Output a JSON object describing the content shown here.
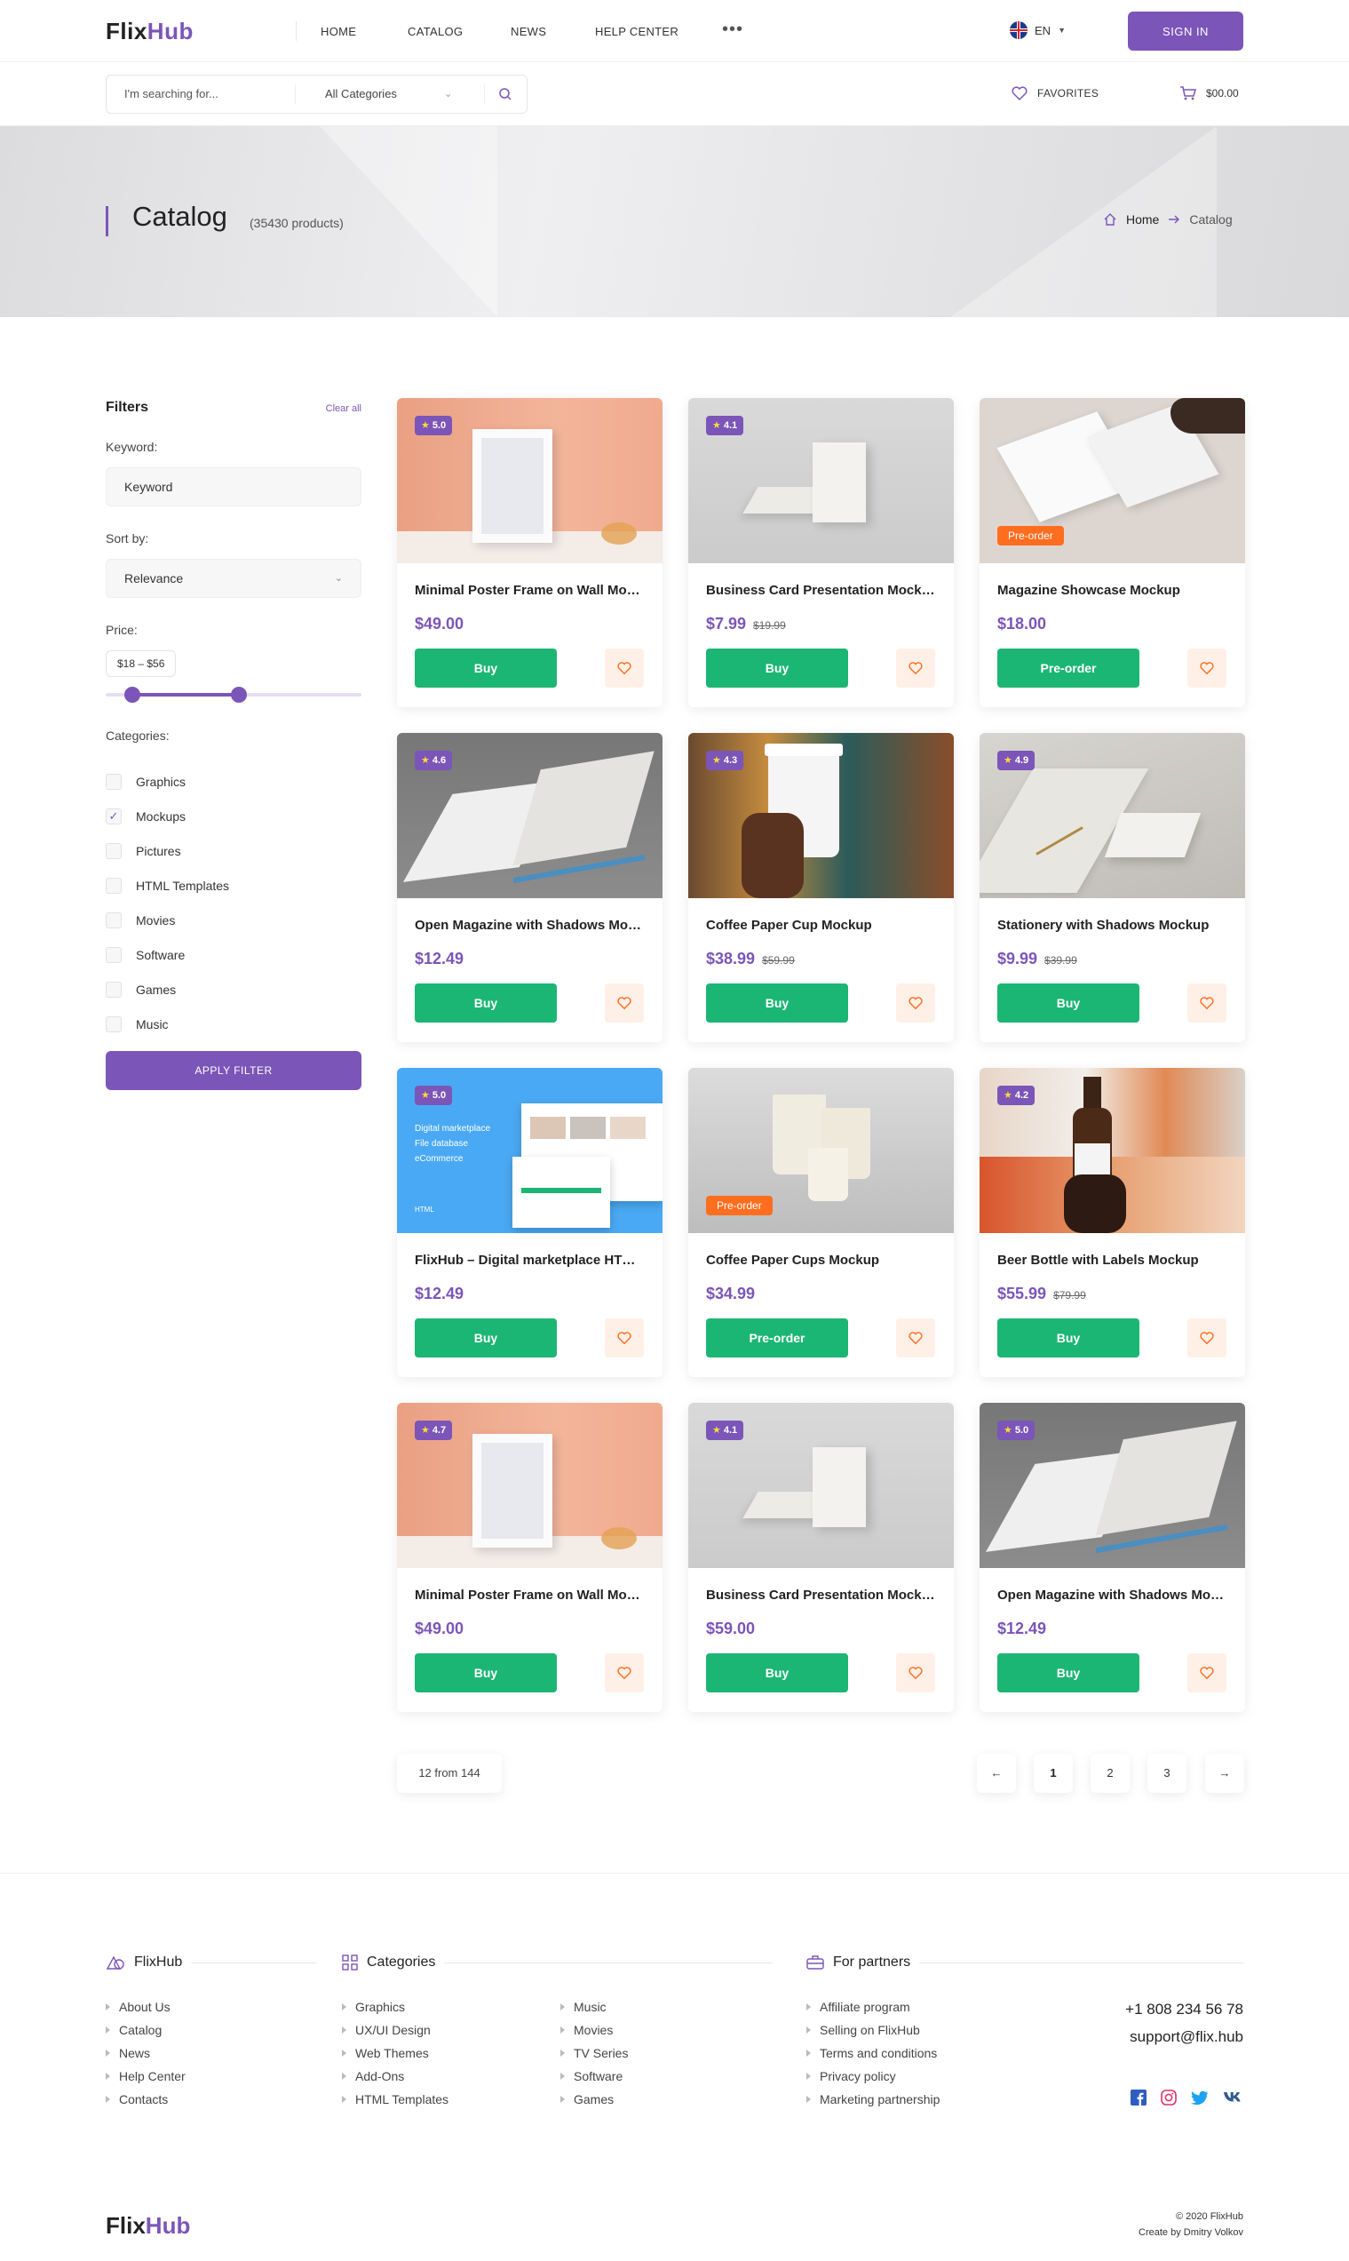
{
  "header": {
    "logo_a": "Flix",
    "logo_b": "Hub",
    "nav": [
      "HOME",
      "CATALOG",
      "NEWS",
      "HELP CENTER"
    ],
    "more": "•••",
    "lang": "EN",
    "signin": "SIGN IN"
  },
  "search": {
    "placeholder": "I'm searching for...",
    "category": "All Categories",
    "favorites": "FAVORITES",
    "cart": "$00.00"
  },
  "hero": {
    "title": "Catalog",
    "count": "(35430 products)",
    "crumb_home": "Home",
    "crumb_current": "Catalog"
  },
  "filters": {
    "title": "Filters",
    "clear": "Clear all",
    "keyword_label": "Keyword:",
    "keyword_placeholder": "Keyword",
    "sort_label": "Sort by:",
    "sort_value": "Relevance",
    "price_label": "Price:",
    "price_range": "$18 – $56",
    "price_min": 18,
    "price_max": 56,
    "categories_label": "Categories:",
    "categories": [
      {
        "label": "Graphics",
        "checked": false
      },
      {
        "label": "Mockups",
        "checked": true
      },
      {
        "label": "Pictures",
        "checked": false
      },
      {
        "label": "HTML Templates",
        "checked": false
      },
      {
        "label": "Movies",
        "checked": false
      },
      {
        "label": "Software",
        "checked": false
      },
      {
        "label": "Games",
        "checked": false
      },
      {
        "label": "Music",
        "checked": false
      }
    ],
    "apply": "APPLY FILTER"
  },
  "products": [
    {
      "title": "Minimal Poster Frame on Wall Mockup",
      "price": "$49.00",
      "old": "",
      "rating": "5.0",
      "badge": "",
      "button": "Buy",
      "img": "frame"
    },
    {
      "title": "Business Card Presentation Mockup",
      "price": "$7.99",
      "old": "$19.99",
      "rating": "4.1",
      "badge": "",
      "button": "Buy",
      "img": "cards"
    },
    {
      "title": "Magazine Showcase Mockup",
      "price": "$18.00",
      "old": "",
      "rating": "",
      "badge": "Pre-order",
      "button": "Pre-order",
      "img": "magazine"
    },
    {
      "title": "Open Magazine with Shadows Mockup",
      "price": "$12.49",
      "old": "",
      "rating": "4.6",
      "badge": "",
      "button": "Buy",
      "img": "openmag"
    },
    {
      "title": "Coffee Paper Cup Mockup",
      "price": "$38.99",
      "old": "$59.99",
      "rating": "4.3",
      "badge": "",
      "button": "Buy",
      "img": "cup"
    },
    {
      "title": "Stationery with Shadows Mockup",
      "price": "$9.99",
      "old": "$39.99",
      "rating": "4.9",
      "badge": "",
      "button": "Buy",
      "img": "stationery"
    },
    {
      "title": "FlixHub – Digital marketplace HTML Template",
      "price": "$12.49",
      "old": "",
      "rating": "5.0",
      "badge": "",
      "button": "Buy",
      "img": "template",
      "img_text": [
        "Digital marketplace",
        "File database",
        "eCommerce",
        "HTML"
      ]
    },
    {
      "title": "Coffee Paper Cups Mockup",
      "price": "$34.99",
      "old": "",
      "rating": "",
      "badge": "Pre-order",
      "button": "Pre-order",
      "img": "cups"
    },
    {
      "title": "Beer Bottle with Labels Mockup",
      "price": "$55.99",
      "old": "$79.99",
      "rating": "4.2",
      "badge": "",
      "button": "Buy",
      "img": "beer"
    },
    {
      "title": "Minimal Poster Frame on Wall Mockup",
      "price": "$49.00",
      "old": "",
      "rating": "4.7",
      "badge": "",
      "button": "Buy",
      "img": "frame"
    },
    {
      "title": "Business Card Presentation Mockup",
      "price": "$59.00",
      "old": "",
      "rating": "4.1",
      "badge": "",
      "button": "Buy",
      "img": "cards"
    },
    {
      "title": "Open Magazine with Shadows Mockup",
      "price": "$12.49",
      "old": "",
      "rating": "5.0",
      "badge": "",
      "button": "Buy",
      "img": "openmag"
    }
  ],
  "pagination": {
    "count": "12 from 144",
    "pages": [
      "1",
      "2",
      "3"
    ],
    "active": "1",
    "prev": "←",
    "next": "→"
  },
  "footer": {
    "brand_head": "FlixHub",
    "brand_links": [
      "About Us",
      "Catalog",
      "News",
      "Help Center",
      "Contacts"
    ],
    "cat_head": "Categories",
    "cat_links_a": [
      "Graphics",
      "UX/UI Design",
      "Web Themes",
      "Add-Ons",
      "HTML Templates"
    ],
    "cat_links_b": [
      "Music",
      "Movies",
      "TV Series",
      "Software",
      "Games"
    ],
    "partners_head": "For partners",
    "partner_links": [
      "Affiliate program",
      "Selling on FlixHub",
      "Terms and conditions",
      "Privacy policy",
      "Marketing partnership"
    ],
    "phone": "+1 808 234 56 78",
    "email": "support@flix.hub",
    "social": [
      "facebook-icon",
      "instagram-icon",
      "twitter-icon",
      "vk-icon"
    ],
    "logo_a": "Flix",
    "logo_b": "Hub",
    "copyright": "© 2020 FlixHub",
    "credit": "Create by Dmitry Volkov"
  },
  "colors": {
    "accent": "#7b55b8",
    "buy": "#1bb673",
    "preorder": "#ff6d1f",
    "heart_bg": "#fff0e7"
  }
}
